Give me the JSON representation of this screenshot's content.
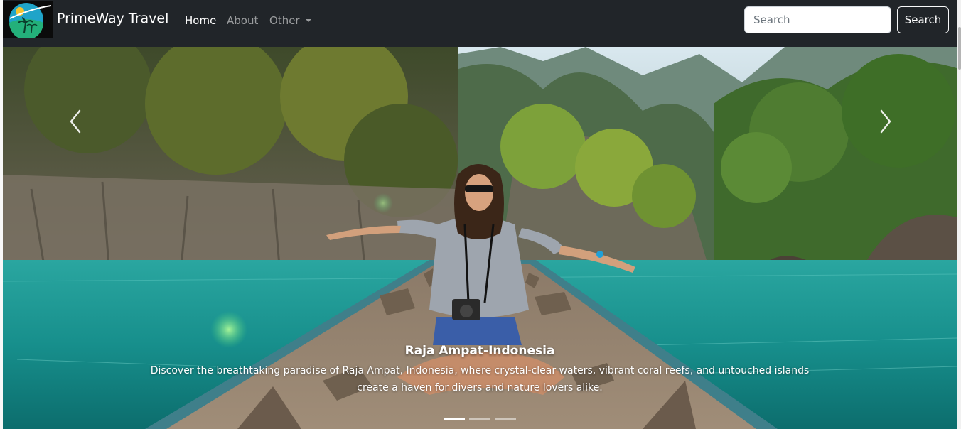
{
  "navbar": {
    "brand": "PrimeWay Travel",
    "links": [
      {
        "label": "Home",
        "active": true
      },
      {
        "label": "About",
        "active": false
      },
      {
        "label": "Other",
        "active": false,
        "dropdown": true
      }
    ],
    "search": {
      "placeholder": "Search",
      "value": "",
      "button_label": "Search"
    }
  },
  "carousel": {
    "active_index": 0,
    "slide_count": 3,
    "caption": {
      "title": "Raja Ampat-Indonesia",
      "text": "Discover the breathtaking paradise of Raja Ampat, Indonesia, where crystal-clear waters, vibrant coral reefs, and untouched islands create a haven for divers and nature lovers alike."
    }
  },
  "icons": [
    "logo-icon",
    "chevron-left-icon",
    "chevron-right-icon",
    "caret-down-icon"
  ],
  "colors": {
    "navbar_bg": "#212529",
    "text_active": "#ffffff",
    "text_muted": "rgba(255,255,255,0.55)",
    "water": "#1c9a96"
  }
}
